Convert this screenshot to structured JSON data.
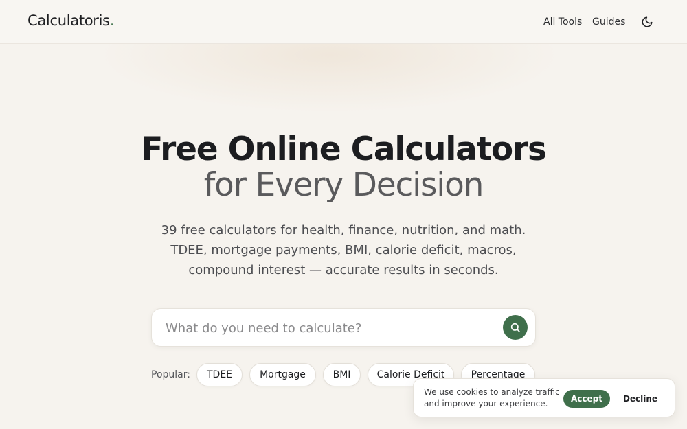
{
  "header": {
    "logo_text": "Calculatoris",
    "logo_dot": ".",
    "nav": [
      {
        "label": "All Tools"
      },
      {
        "label": "Guides"
      }
    ],
    "theme_icon": "moon-icon"
  },
  "hero": {
    "title_line1": "Free Online Calculators",
    "title_line2": "for Every Decision",
    "subtitle": "39 free calculators for health, finance, nutrition, and math. TDEE, mortgage payments, BMI, calorie deficit, macros, compound interest — accurate results in seconds."
  },
  "search": {
    "placeholder": "What do you need to calculate?",
    "value": "",
    "button_icon": "search-icon"
  },
  "popular": {
    "label": "Popular:",
    "chips": [
      {
        "label": "TDEE"
      },
      {
        "label": "Mortgage"
      },
      {
        "label": "BMI"
      },
      {
        "label": "Calorie Deficit"
      },
      {
        "label": "Percentage"
      }
    ]
  },
  "cookie": {
    "text": "We use cookies to analyze traffic and improve your experience.",
    "accept_label": "Accept",
    "decline_label": "Decline"
  },
  "colors": {
    "accent": "#3f6f4b",
    "background": "#f6f3ee",
    "text": "#1e1f22"
  }
}
